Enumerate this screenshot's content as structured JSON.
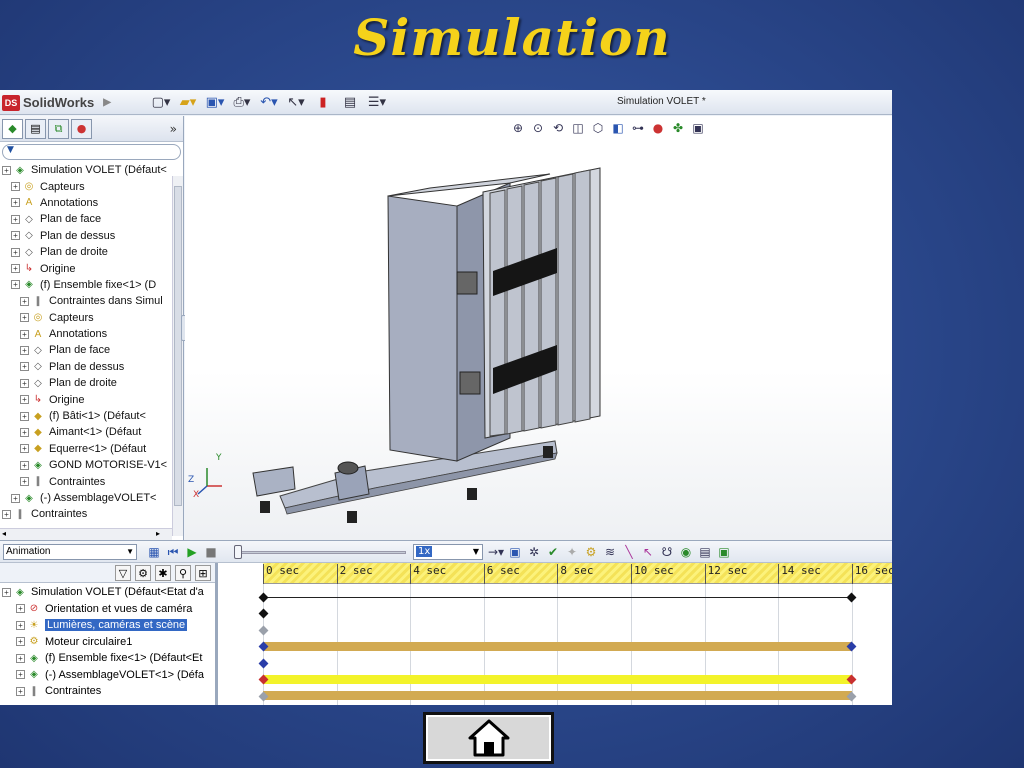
{
  "slide": {
    "title": "Simulation"
  },
  "app": {
    "logo_text": "SolidWorks",
    "document_title": "Simulation VOLET *"
  },
  "feature_tree": {
    "filter_label": "▼",
    "items": [
      {
        "label": "Simulation VOLET  (Défaut<",
        "icon": "assembly-icon",
        "level": 0
      },
      {
        "label": "Capteurs",
        "icon": "sensor-icon",
        "level": 1
      },
      {
        "label": "Annotations",
        "icon": "annotations-icon",
        "level": 1
      },
      {
        "label": "Plan de face",
        "icon": "plane-icon",
        "level": 1
      },
      {
        "label": "Plan de dessus",
        "icon": "plane-icon",
        "level": 1
      },
      {
        "label": "Plan de droite",
        "icon": "plane-icon",
        "level": 1
      },
      {
        "label": "Origine",
        "icon": "origin-icon",
        "level": 1
      },
      {
        "label": "(f) Ensemble fixe<1> (D",
        "icon": "subassembly-icon",
        "level": 1
      },
      {
        "label": "Contraintes dans Simul",
        "icon": "mates-icon",
        "level": 2
      },
      {
        "label": "Capteurs",
        "icon": "sensor-icon",
        "level": 2
      },
      {
        "label": "Annotations",
        "icon": "annotations-icon",
        "level": 2
      },
      {
        "label": "Plan de face",
        "icon": "plane-icon",
        "level": 2
      },
      {
        "label": "Plan de dessus",
        "icon": "plane-icon",
        "level": 2
      },
      {
        "label": "Plan de droite",
        "icon": "plane-icon",
        "level": 2
      },
      {
        "label": "Origine",
        "icon": "origin-icon",
        "level": 2
      },
      {
        "label": "(f) Bâti<1> (Défaut<",
        "icon": "part-icon",
        "level": 2
      },
      {
        "label": "Aimant<1> (Défaut",
        "icon": "part-icon",
        "level": 2
      },
      {
        "label": "Equerre<1> (Défaut",
        "icon": "part-icon",
        "level": 2
      },
      {
        "label": "GOND MOTORISE-V1<",
        "icon": "subassembly-icon",
        "level": 2
      },
      {
        "label": "Contraintes",
        "icon": "mates-icon",
        "level": 2
      },
      {
        "label": "(-) AssemblageVOLET<",
        "icon": "subassembly-icon",
        "level": 1
      },
      {
        "label": "Contraintes",
        "icon": "mates-icon",
        "level": 0
      }
    ]
  },
  "animation": {
    "study_type": "Animation",
    "speed": "1x",
    "timeline_labels": [
      "0 sec",
      "2 sec",
      "4 sec",
      "6 sec",
      "8 sec",
      "10 sec",
      "12 sec",
      "14 sec",
      "16 sec"
    ],
    "tree": [
      {
        "label": "Simulation VOLET  (Défaut<Etat d'a",
        "icon": "assembly-icon",
        "level": 0
      },
      {
        "label": "Orientation et vues de caméra",
        "icon": "camera-views-icon",
        "level": 1
      },
      {
        "label": "Lumières, caméras et scène",
        "icon": "lights-icon",
        "level": 1,
        "selected": true
      },
      {
        "label": "Moteur circulaire1",
        "icon": "motor-icon",
        "level": 1
      },
      {
        "label": "(f) Ensemble fixe<1> (Défaut<Et",
        "icon": "subassembly-icon",
        "level": 1
      },
      {
        "label": "(-) AssemblageVOLET<1> (Défa",
        "icon": "subassembly-icon",
        "level": 1
      },
      {
        "label": "Contraintes",
        "icon": "mates-icon",
        "level": 1
      }
    ],
    "tracks": [
      {
        "row": 0,
        "key_start_sec": 0,
        "key_end_sec": 16,
        "bar_color": "",
        "key_color": "#111111"
      },
      {
        "row": 1,
        "key_start_sec": 0,
        "key_end_sec": null,
        "bar_color": "",
        "key_color": "#111111"
      },
      {
        "row": 2,
        "key_start_sec": 0,
        "key_end_sec": null,
        "bar_color": "",
        "key_color": "#9aa0aa"
      },
      {
        "row": 3,
        "key_start_sec": 0,
        "key_end_sec": 16,
        "bar_color": "#d2aa52",
        "key_color": "#2a3da8"
      },
      {
        "row": 4,
        "key_start_sec": 0,
        "key_end_sec": null,
        "bar_color": "",
        "key_color": "#2a3da8"
      },
      {
        "row": 5,
        "key_start_sec": 0,
        "key_end_sec": 16,
        "bar_color": "#f3f32a",
        "key_color": "#c83030"
      },
      {
        "row": 6,
        "key_start_sec": 0,
        "key_end_sec": 16,
        "bar_color": "#d2aa52",
        "key_color": "#9aa0aa"
      }
    ]
  },
  "home_button": {
    "icon": "home-icon"
  }
}
